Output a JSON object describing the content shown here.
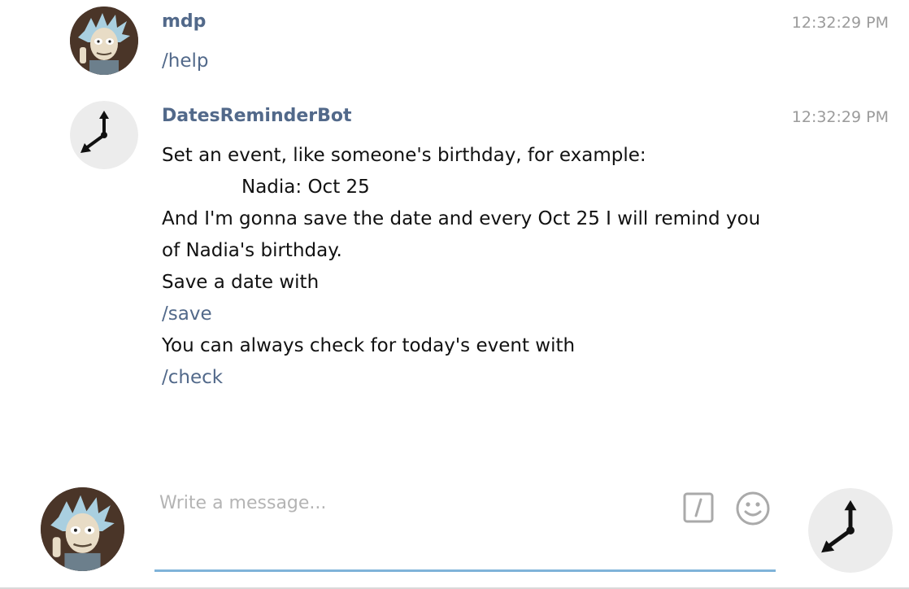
{
  "messages": [
    {
      "sender": "mdp",
      "time": "12:32:29 PM",
      "avatar_icon": "rick-avatar",
      "lines": [
        {
          "text": "/help",
          "type": "command"
        }
      ]
    },
    {
      "sender": "DatesReminderBot",
      "time": "12:32:29 PM",
      "avatar_icon": "clock-avatar",
      "lines": [
        {
          "text": "Set an event, like someone's birthday, for example:",
          "type": "text"
        },
        {
          "text": "Nadia: Oct 25",
          "type": "indent"
        },
        {
          "text": "And I'm gonna save the date and every Oct 25 I will remind you",
          "type": "text"
        },
        {
          "text": "of Nadia's birthday.",
          "type": "text"
        },
        {
          "text": "Save a date with",
          "type": "text"
        },
        {
          "text": "/save",
          "type": "command"
        },
        {
          "text": "You can always check for today's event with",
          "type": "text"
        },
        {
          "text": "/check",
          "type": "command"
        }
      ]
    }
  ],
  "composer": {
    "placeholder": "Write a message...",
    "value": "",
    "commands_icon": "slash-command-icon",
    "emoji_icon": "smiley-icon",
    "send_avatar_icon": "clock-avatar"
  },
  "colors": {
    "sender": "#52698a",
    "command": "#52698a",
    "timestamp": "#9b9b9b",
    "accent_underline": "#7fb3d9"
  }
}
